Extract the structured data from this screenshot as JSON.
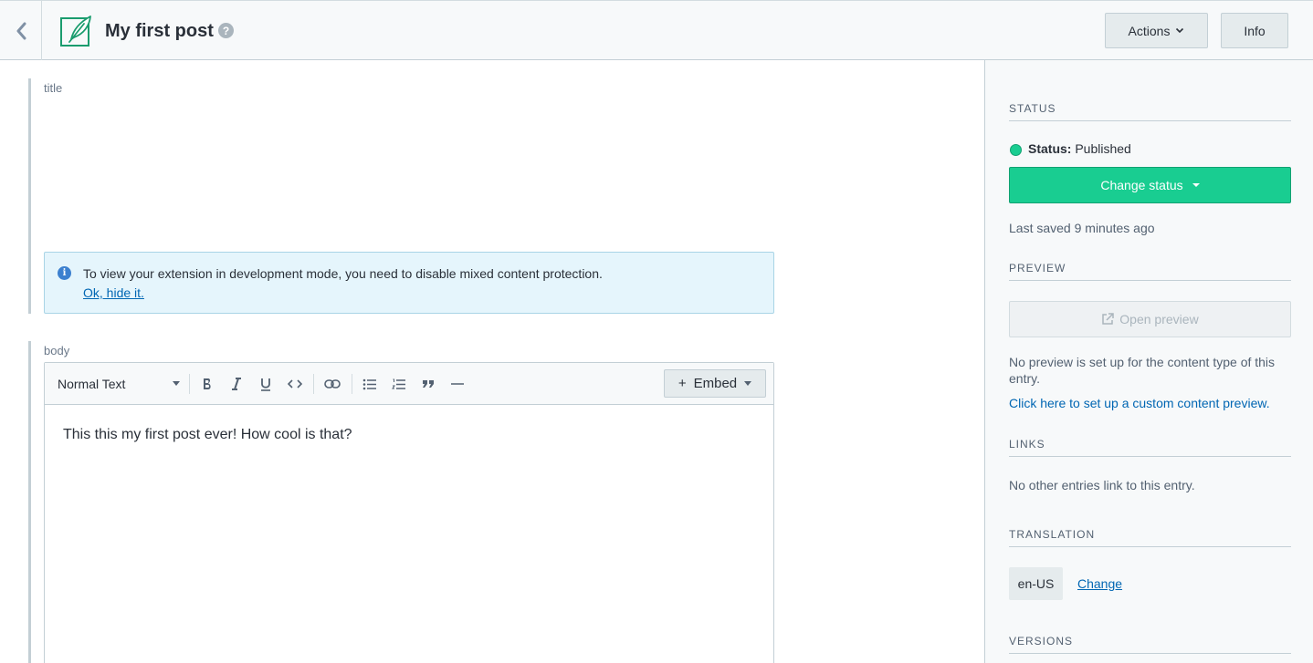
{
  "header": {
    "title": "My first post",
    "help_glyph": "?",
    "actions_label": "Actions",
    "info_label": "Info"
  },
  "fields": {
    "title_label": "title",
    "body_label": "body"
  },
  "notice": {
    "info_glyph": "i",
    "text": "To view your extension in development mode, you need to disable mixed content protection.",
    "dismiss_link": "Ok, hide it."
  },
  "editor": {
    "format_select": "Normal Text",
    "embed_label": "Embed",
    "embed_plus": "+",
    "content": "This this my first post ever! How cool is that?"
  },
  "sidebar": {
    "status": {
      "heading": "STATUS",
      "label": "Status:",
      "value": "Published",
      "change_button": "Change status",
      "last_saved": "Last saved 9 minutes ago"
    },
    "preview": {
      "heading": "PREVIEW",
      "open_button": "Open preview",
      "message": "No preview is set up for the content type of this entry.",
      "setup_link": "Click here to set up a custom content preview."
    },
    "links": {
      "heading": "LINKS",
      "message": "No other entries link to this entry."
    },
    "translation": {
      "heading": "TRANSLATION",
      "locale": "en-US",
      "change_link": "Change"
    },
    "versions": {
      "heading": "VERSIONS"
    }
  },
  "colors": {
    "accent_green": "#19cd91",
    "link_blue": "#0066b3",
    "notice_bg": "#e5f5fc"
  },
  "icons": {
    "back": "chevron-left-icon",
    "entry": "feather-icon",
    "help": "question-icon",
    "info": "info-icon",
    "external": "external-link-icon"
  }
}
